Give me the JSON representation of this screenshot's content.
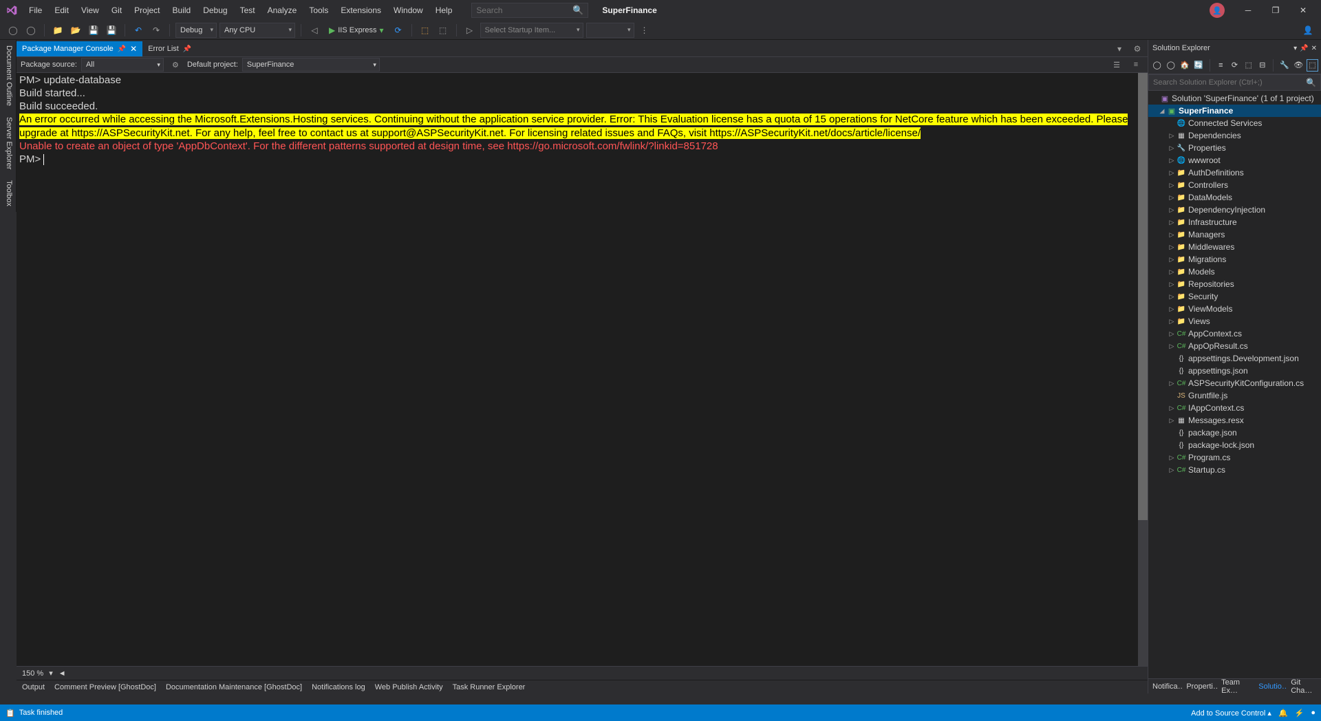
{
  "menu": [
    "File",
    "Edit",
    "View",
    "Git",
    "Project",
    "Build",
    "Debug",
    "Test",
    "Analyze",
    "Tools",
    "Extensions",
    "Window",
    "Help"
  ],
  "search_placeholder": "Search",
  "app_name": "SuperFinance",
  "toolbar": {
    "config": "Debug",
    "platform": "Any CPU",
    "run_label": "IIS Express",
    "startup": "Select Startup Item..."
  },
  "left_rail": [
    "Document Outline",
    "Server Explorer",
    "Toolbox"
  ],
  "tabs": {
    "active": "Package Manager Console",
    "other": "Error List"
  },
  "pmc": {
    "source_label": "Package source:",
    "source_value": "All",
    "project_label": "Default project:",
    "project_value": "SuperFinance"
  },
  "console": {
    "prompt": "PM>",
    "cmd": "update-database",
    "line1": "Build started...",
    "line2": "Build succeeded.",
    "warn": "An error occurred while accessing the Microsoft.Extensions.Hosting services. Continuing without the application service provider. Error: This Evaluation license has a quota of 15 operations for NetCore feature which has been exceeded. Please upgrade at https://ASPSecurityKit.net. For any help, feel free to contact us at support@ASPSecurityKit.net. For licensing related issues and FAQs, visit https://ASPSecurityKit.net/docs/article/license/",
    "err": "Unable to create an object of type 'AppDbContext'. For the different patterns supported at design time, see https://go.microsoft.com/fwlink/?linkid=851728"
  },
  "zoom": "150 %",
  "bottom_tabs": [
    "Output",
    "Comment Preview [GhostDoc]",
    "Documentation Maintenance [GhostDoc]",
    "Notifications log",
    "Web Publish Activity",
    "Task Runner Explorer"
  ],
  "solution_explorer": {
    "title": "Solution Explorer",
    "search_placeholder": "Search Solution Explorer (Ctrl+;)",
    "solution": "Solution 'SuperFinance' (1 of 1 project)",
    "project": "SuperFinance",
    "nodes": [
      {
        "label": "Connected Services",
        "icon": "globe",
        "arrow": ""
      },
      {
        "label": "Dependencies",
        "icon": "ref",
        "arrow": "▷"
      },
      {
        "label": "Properties",
        "icon": "wrench",
        "arrow": "▷"
      },
      {
        "label": "wwwroot",
        "icon": "globe",
        "arrow": "▷"
      },
      {
        "label": "AuthDefinitions",
        "icon": "folder",
        "arrow": "▷"
      },
      {
        "label": "Controllers",
        "icon": "folder",
        "arrow": "▷"
      },
      {
        "label": "DataModels",
        "icon": "folder",
        "arrow": "▷"
      },
      {
        "label": "DependencyInjection",
        "icon": "folder",
        "arrow": "▷"
      },
      {
        "label": "Infrastructure",
        "icon": "folder",
        "arrow": "▷"
      },
      {
        "label": "Managers",
        "icon": "folder",
        "arrow": "▷"
      },
      {
        "label": "Middlewares",
        "icon": "folder",
        "arrow": "▷"
      },
      {
        "label": "Migrations",
        "icon": "folder",
        "arrow": "▷"
      },
      {
        "label": "Models",
        "icon": "folder",
        "arrow": "▷"
      },
      {
        "label": "Repositories",
        "icon": "folder",
        "arrow": "▷"
      },
      {
        "label": "Security",
        "icon": "folder",
        "arrow": "▷"
      },
      {
        "label": "ViewModels",
        "icon": "folder",
        "arrow": "▷"
      },
      {
        "label": "Views",
        "icon": "folder",
        "arrow": "▷"
      },
      {
        "label": "AppContext.cs",
        "icon": "cs",
        "arrow": "▷"
      },
      {
        "label": "AppOpResult.cs",
        "icon": "cs",
        "arrow": "▷"
      },
      {
        "label": "appsettings.Development.json",
        "icon": "json",
        "arrow": ""
      },
      {
        "label": "appsettings.json",
        "icon": "json",
        "arrow": ""
      },
      {
        "label": "ASPSecurityKitConfiguration.cs",
        "icon": "cs",
        "arrow": "▷"
      },
      {
        "label": "Gruntfile.js",
        "icon": "js",
        "arrow": ""
      },
      {
        "label": "IAppContext.cs",
        "icon": "cs",
        "arrow": "▷"
      },
      {
        "label": "Messages.resx",
        "icon": "file",
        "arrow": "▷"
      },
      {
        "label": "package.json",
        "icon": "json",
        "arrow": ""
      },
      {
        "label": "package-lock.json",
        "icon": "json",
        "arrow": ""
      },
      {
        "label": "Program.cs",
        "icon": "cs",
        "arrow": "▷"
      },
      {
        "label": "Startup.cs",
        "icon": "cs",
        "arrow": "▷"
      }
    ],
    "bottom_tabs": [
      "Notifica…",
      "Properti…",
      "Team Ex…",
      "Solutio…",
      "Git Cha…"
    ]
  },
  "status": {
    "text": "Task finished",
    "source_control": "Add to Source Control"
  }
}
